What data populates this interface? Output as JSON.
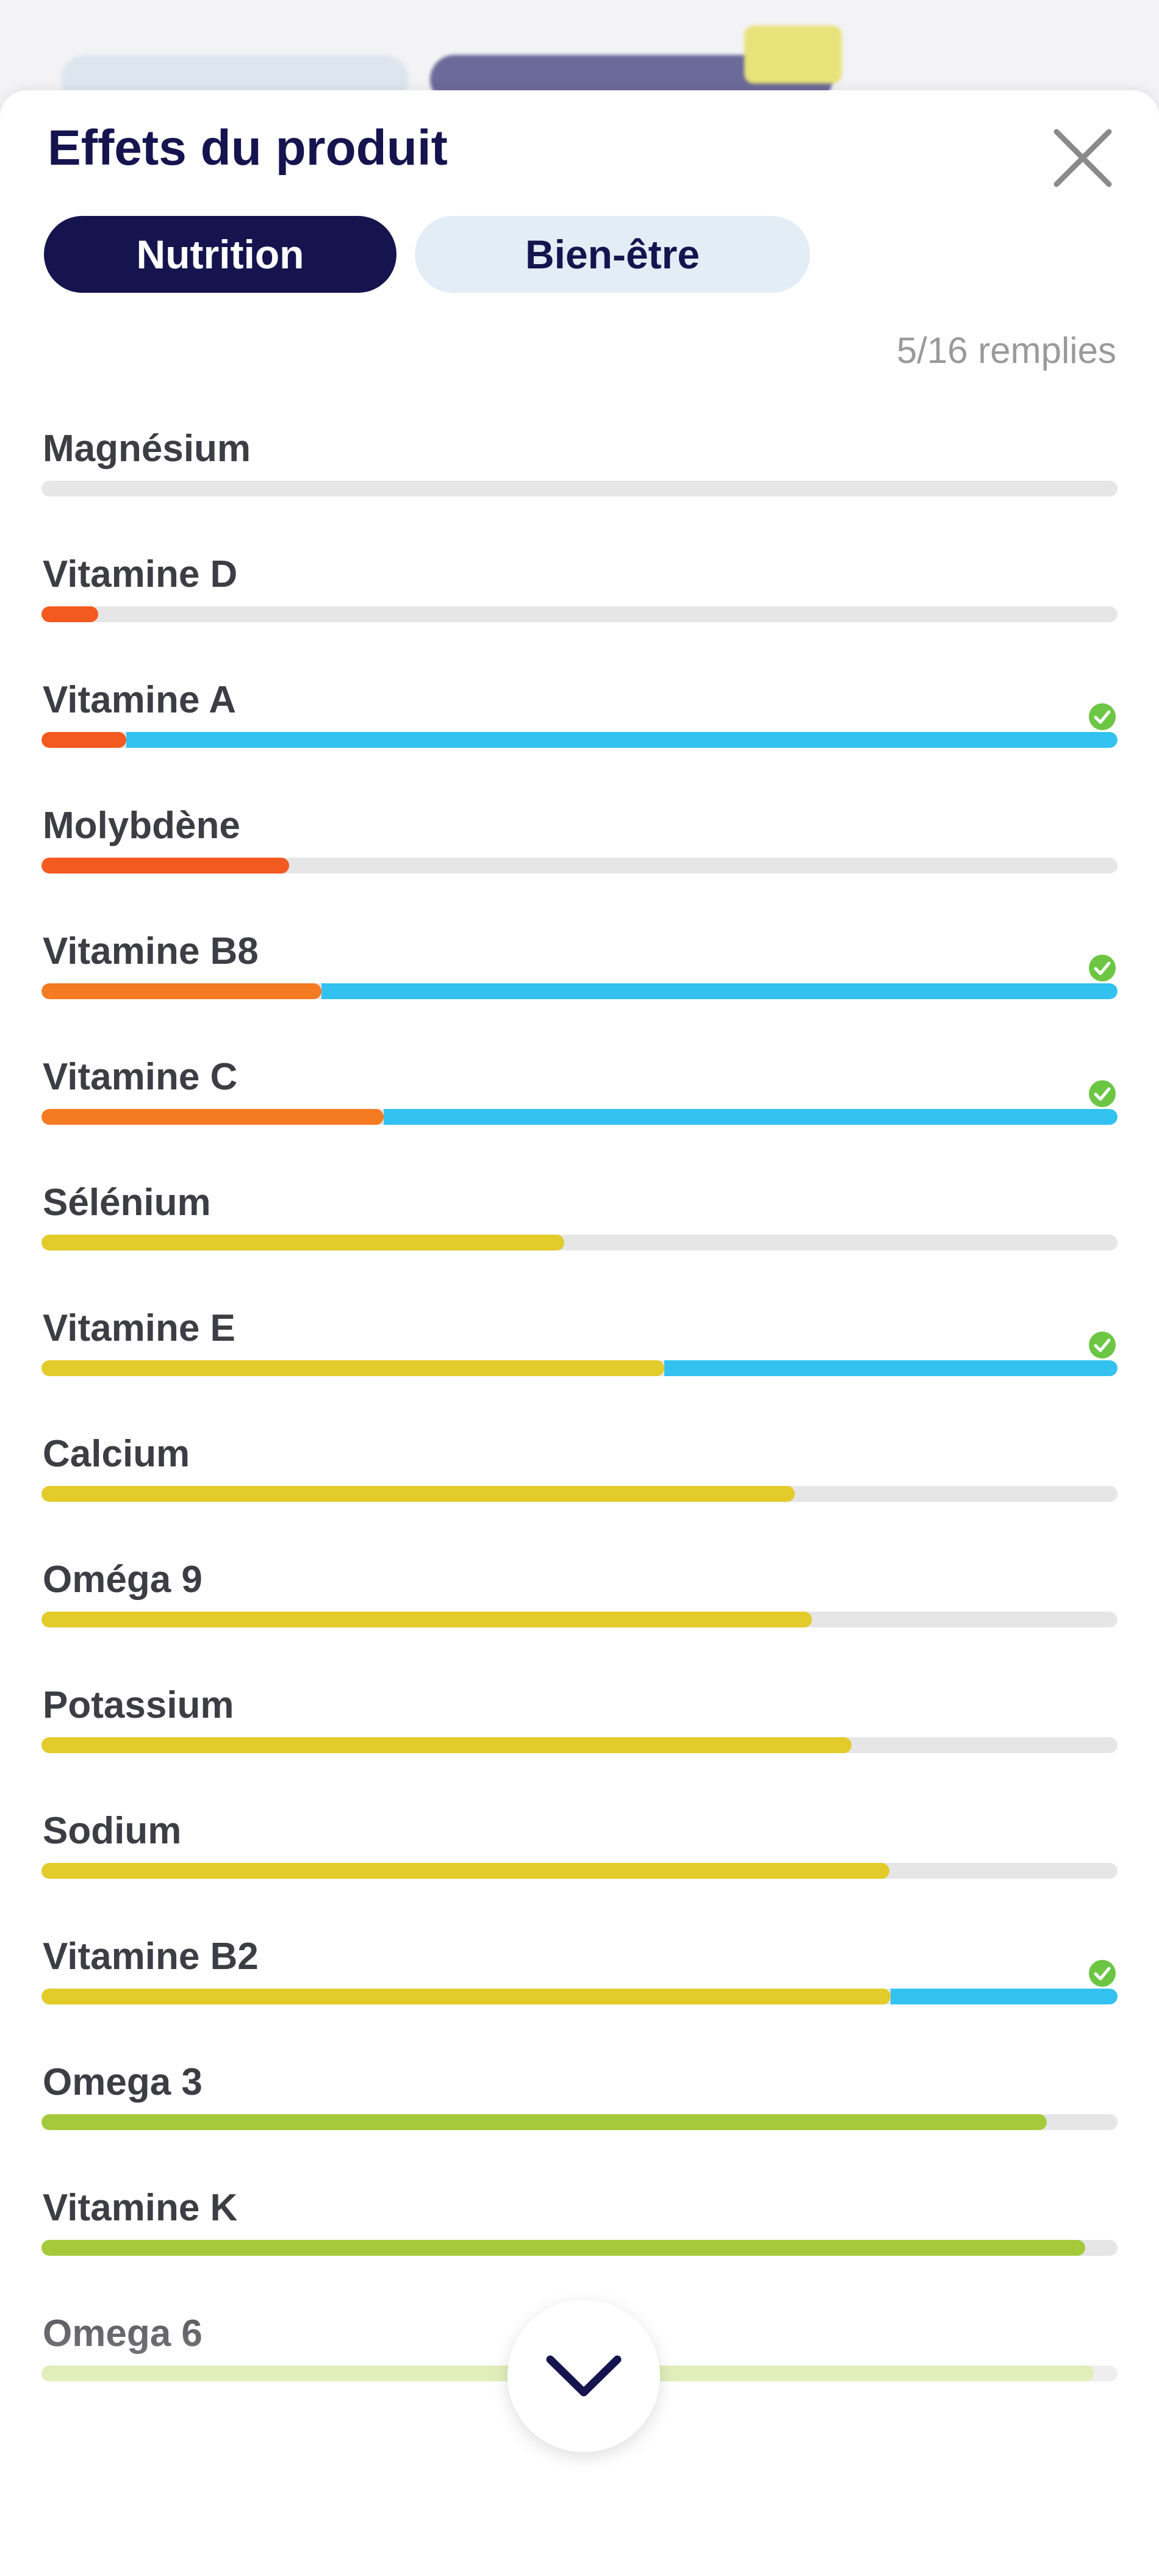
{
  "sheet": {
    "title": "Effets du produit",
    "close_icon": "close-icon",
    "tabs": [
      {
        "label": "Nutrition",
        "active": true
      },
      {
        "label": "Bien-être",
        "active": false
      }
    ],
    "fill_count": "5/16 remplies"
  },
  "colors": {
    "navy": "#16144f",
    "orange": "#f35a20",
    "orange_light": "#f57b22",
    "yellow": "#e2cb2a",
    "green": "#a4c93a",
    "green_light": "#d3e699",
    "blue": "#33c2f0",
    "track": "#e6e6e6",
    "check": "#6cc644"
  },
  "items": [
    {
      "label": "Magnésium",
      "value": 0.0,
      "color": "#f35a20",
      "filled": false
    },
    {
      "label": "Vitamine D",
      "value": 0.053,
      "color": "#f35a20",
      "filled": false
    },
    {
      "label": "Vitamine A",
      "value": 0.079,
      "color": "#f35a20",
      "filled": true
    },
    {
      "label": "Molybdène",
      "value": 0.23,
      "color": "#f35a20",
      "filled": false
    },
    {
      "label": "Vitamine B8",
      "value": 0.26,
      "color": "#f57b22",
      "filled": true
    },
    {
      "label": "Vitamine C",
      "value": 0.318,
      "color": "#f57b22",
      "filled": true
    },
    {
      "label": "Sélénium",
      "value": 0.486,
      "color": "#e2cb2a",
      "filled": false
    },
    {
      "label": "Vitamine E",
      "value": 0.579,
      "color": "#e2cb2a",
      "filled": true
    },
    {
      "label": "Calcium",
      "value": 0.7,
      "color": "#e2cb2a",
      "filled": false
    },
    {
      "label": "Oméga 9",
      "value": 0.716,
      "color": "#e2cb2a",
      "filled": false
    },
    {
      "label": "Potassium",
      "value": 0.753,
      "color": "#e2cb2a",
      "filled": false
    },
    {
      "label": "Sodium",
      "value": 0.788,
      "color": "#e2cb2a",
      "filled": false
    },
    {
      "label": "Vitamine B2",
      "value": 0.789,
      "color": "#e2cb2a",
      "filled": true
    },
    {
      "label": "Omega 3",
      "value": 0.934,
      "color": "#a4c93a",
      "filled": false
    },
    {
      "label": "Vitamine K",
      "value": 0.97,
      "color": "#a4c93a",
      "filled": false
    },
    {
      "label": "Omega 6",
      "value": 0.978,
      "color": "#d3e699",
      "filled": false
    }
  ],
  "scroll_button": {
    "icon": "chevron-down-icon"
  }
}
